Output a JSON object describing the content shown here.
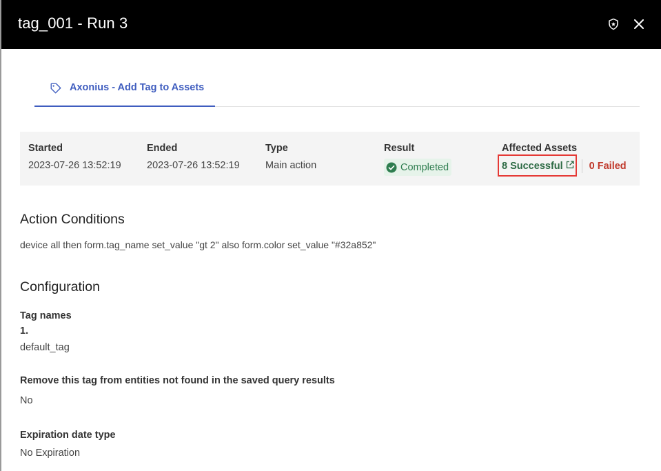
{
  "header": {
    "title": "tag_001 - Run 3",
    "icons": [
      "shield-icon",
      "close-icon"
    ]
  },
  "tabs": [
    {
      "label": "Axonius - Add Tag to Assets",
      "icon": "tag-icon",
      "active": true
    }
  ],
  "summary": {
    "started": {
      "label": "Started",
      "value": "2023-07-26 13:52:19"
    },
    "ended": {
      "label": "Ended",
      "value": "2023-07-26 13:52:19"
    },
    "type": {
      "label": "Type",
      "value": "Main action"
    },
    "result": {
      "label": "Result",
      "value": "Completed",
      "icon": "check-circle-icon"
    },
    "affected_assets": {
      "label": "Affected Assets",
      "successful": "8 Successful",
      "failed": "0 Failed",
      "link_icon": "external-link-icon"
    }
  },
  "action_conditions": {
    "title": "Action Conditions",
    "text": "device all then form.tag_name set_value \"gt 2\" also form.color set_value \"#32a852\""
  },
  "configuration": {
    "title": "Configuration",
    "tag_names": {
      "label": "Tag names",
      "index": "1.",
      "value": "default_tag"
    },
    "remove_tag": {
      "label": "Remove this tag from entities not found in the saved query results",
      "value": "No"
    },
    "expiration": {
      "label": "Expiration date type",
      "value": "No Expiration"
    }
  },
  "colors": {
    "header_bg": "#000000",
    "accent": "#3f5dbf",
    "success": "#2e7d4f",
    "failed": "#c0392b",
    "highlight": "#e53935"
  }
}
